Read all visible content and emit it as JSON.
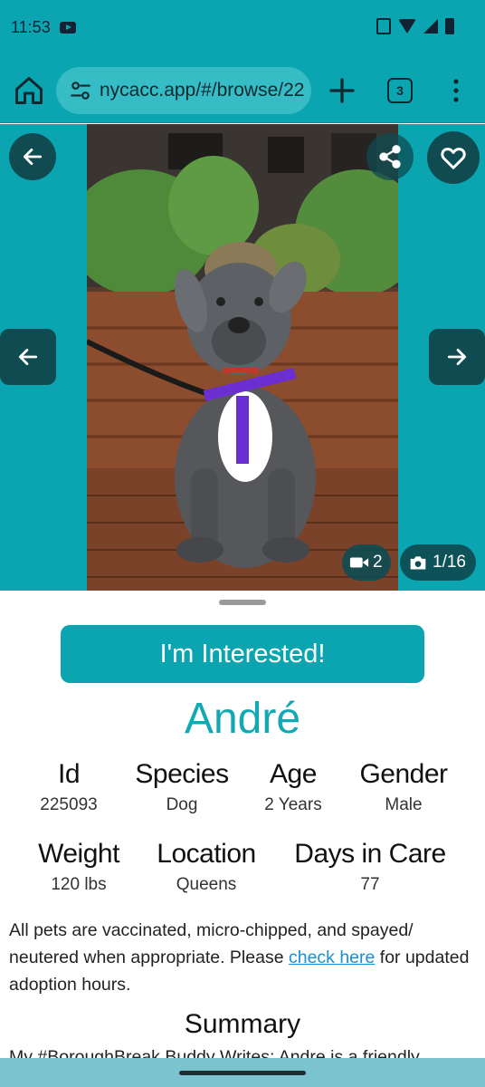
{
  "status_bar": {
    "time": "11:53",
    "icons": [
      "youtube-icon",
      "vibrate-icon",
      "wifi-icon",
      "signal-icon",
      "battery-icon"
    ]
  },
  "browser": {
    "url": "nycacc.app/#/browse/22",
    "tab_count": "3",
    "icons": [
      "home-icon",
      "site-settings-icon",
      "plus-icon",
      "tabs-icon",
      "menu-icon"
    ]
  },
  "gallery": {
    "video_count": "2",
    "photo_counter": "1/16",
    "icons": [
      "back-arrow-icon",
      "share-icon",
      "heart-icon",
      "prev-arrow-icon",
      "next-arrow-icon",
      "video-camera-icon",
      "camera-icon"
    ]
  },
  "pet": {
    "interest_button": "I'm Interested!",
    "name": "André",
    "stats_row1": [
      {
        "label": "Id",
        "value": "225093"
      },
      {
        "label": "Species",
        "value": "Dog"
      },
      {
        "label": "Age",
        "value": "2 Years"
      },
      {
        "label": "Gender",
        "value": "Male"
      }
    ],
    "stats_row2": [
      {
        "label": "Weight",
        "value": "120 lbs"
      },
      {
        "label": "Location",
        "value": "Queens"
      },
      {
        "label": "Days in Care",
        "value": "77"
      }
    ],
    "note_before": "All pets are vaccinated, micro-chipped, and spayed/ neutered when appropriate. Please ",
    "note_link": "check here",
    "note_after": " for updated adoption hours.",
    "summary_title": "Summary",
    "summary_text": "My #BoroughBreak Buddy Writes: Andre is a friendly"
  },
  "colors": {
    "teal": "#0aa5b0",
    "dark_teal": "#0f4b51",
    "name_color": "#12a8b4",
    "link": "#1a8fd6"
  }
}
